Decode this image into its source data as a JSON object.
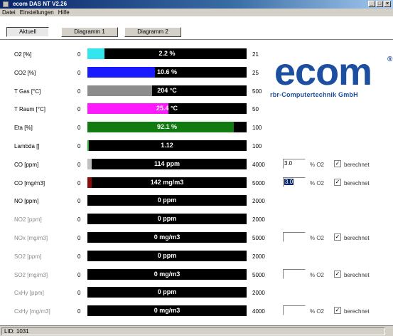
{
  "window": {
    "title": "ecom DAS NT V2.26",
    "controls": [
      "_",
      "□",
      "×"
    ]
  },
  "menu": [
    "Datei",
    "Einstellungen",
    "Hilfe"
  ],
  "tabs": [
    "Aktuell",
    "Diagramm 1",
    "Diagramm 2"
  ],
  "active_tab": "Aktuell",
  "logo": {
    "text": "ecom",
    "reg": "®",
    "subtitle": "rbr-Computertechnik GmbH"
  },
  "colors": {
    "o2": "#33e6ee",
    "co2": "#1a1aff",
    "tgas": "#8c8c8c",
    "traum": "#ff19ff",
    "eta": "#117a11",
    "lambda": "#22bb22",
    "co": "#bfbfbf",
    "co_mg": "#8b0a0a"
  },
  "rows": [
    {
      "label": "O2 [%]",
      "min": "0",
      "max": "21",
      "value": "2.2 %",
      "fill": 0.105,
      "color": "#33e6ee",
      "dim": false
    },
    {
      "label": "CO2 [%]",
      "min": "0",
      "max": "25",
      "value": "10.6 %",
      "fill": 0.424,
      "color": "#1a1aff",
      "dim": false
    },
    {
      "label": "T Gas [°C]",
      "min": "0",
      "max": "500",
      "value": "204 °C",
      "fill": 0.408,
      "color": "#8c8c8c",
      "dim": false
    },
    {
      "label": "T Raum [°C]",
      "min": "0",
      "max": "50",
      "value": "25.4 °C",
      "fill": 0.508,
      "color": "#ff19ff",
      "dim": false
    },
    {
      "label": "Eta [%]",
      "min": "0",
      "max": "100",
      "value": "92.1 %",
      "fill": 0.921,
      "color": "#117a11",
      "dim": false
    },
    {
      "label": "Lambda []",
      "min": "0",
      "max": "100",
      "value": "1.12",
      "fill": 0.011,
      "color": "#22bb22",
      "dim": false
    },
    {
      "label": "CO [ppm]",
      "min": "0",
      "max": "4000",
      "value": "114 ppm",
      "fill": 0.0285,
      "color": "#bfbfbf",
      "dim": false,
      "o2ref": "3.0",
      "o2_label": "% O2",
      "checked": true,
      "check_label": "berechnet"
    },
    {
      "label": "CO [mg/m3]",
      "min": "0",
      "max": "5000",
      "value": "142 mg/m3",
      "fill": 0.0284,
      "color": "#8b0a0a",
      "dim": false,
      "o2ref": "3.0",
      "o2_selected": true,
      "o2_label": "% O2",
      "checked": true,
      "check_label": "berechnet"
    },
    {
      "label": "NO [ppm]",
      "min": "0",
      "max": "2000",
      "value": "0 ppm",
      "fill": 0,
      "color": "#000000",
      "dim": false
    },
    {
      "label": "NO2 [ppm]",
      "min": "0",
      "max": "2000",
      "value": "0 ppm",
      "fill": 0,
      "color": "#000000",
      "dim": true
    },
    {
      "label": "NOx [mg/m3]",
      "min": "0",
      "max": "5000",
      "value": "0 mg/m3",
      "fill": 0,
      "color": "#000000",
      "dim": true,
      "o2ref": "",
      "o2_label": "% O2",
      "checked": true,
      "check_label": "berechnet"
    },
    {
      "label": "SO2 [ppm]",
      "min": "0",
      "max": "2000",
      "value": "0 ppm",
      "fill": 0,
      "color": "#000000",
      "dim": true
    },
    {
      "label": "SO2 [mg/m3]",
      "min": "0",
      "max": "5000",
      "value": "0 mg/m3",
      "fill": 0,
      "color": "#000000",
      "dim": true,
      "o2ref": "",
      "o2_label": "% O2",
      "checked": true,
      "check_label": "berechnet"
    },
    {
      "label": "CxHy [ppm]",
      "min": "0",
      "max": "2000",
      "value": "0 ppm",
      "fill": 0,
      "color": "#000000",
      "dim": true
    },
    {
      "label": "CxHy [mg/m3]",
      "min": "0",
      "max": "4000",
      "value": "0 mg/m3",
      "fill": 0,
      "color": "#000000",
      "dim": true,
      "o2ref": "",
      "o2_label": "% O2",
      "checked": true,
      "check_label": "berechnet"
    }
  ],
  "status": "LID: 1031"
}
